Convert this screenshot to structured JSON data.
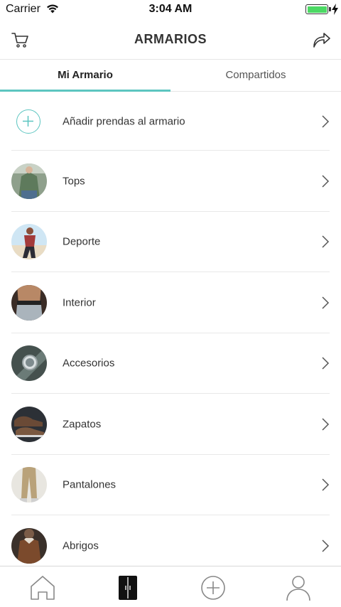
{
  "status_bar": {
    "carrier": "Carrier",
    "time": "3:04 AM",
    "battery_level": 1.0
  },
  "header": {
    "title": "ARMARIOS",
    "left_icon": "cart-icon",
    "right_icon": "share-arrow-icon"
  },
  "tabs": [
    {
      "label": "Mi Armario",
      "active": true
    },
    {
      "label": "Compartidos",
      "active": false
    }
  ],
  "list": {
    "add_item_label": "Añadir prendas al armario",
    "categories": [
      {
        "label": "Tops"
      },
      {
        "label": "Deporte"
      },
      {
        "label": "Interior"
      },
      {
        "label": "Accesorios"
      },
      {
        "label": "Zapatos"
      },
      {
        "label": "Pantalones"
      },
      {
        "label": "Abrigos"
      }
    ]
  },
  "tab_bar": {
    "items": [
      {
        "icon": "home-icon",
        "active": false
      },
      {
        "icon": "wardrobe-icon",
        "active": true
      },
      {
        "icon": "add-circle-icon",
        "active": false
      },
      {
        "icon": "profile-icon",
        "active": false
      }
    ]
  },
  "colors": {
    "accent": "#5cc5c0",
    "text": "#333333",
    "divider": "#e8e8e8",
    "battery": "#4cd964"
  }
}
